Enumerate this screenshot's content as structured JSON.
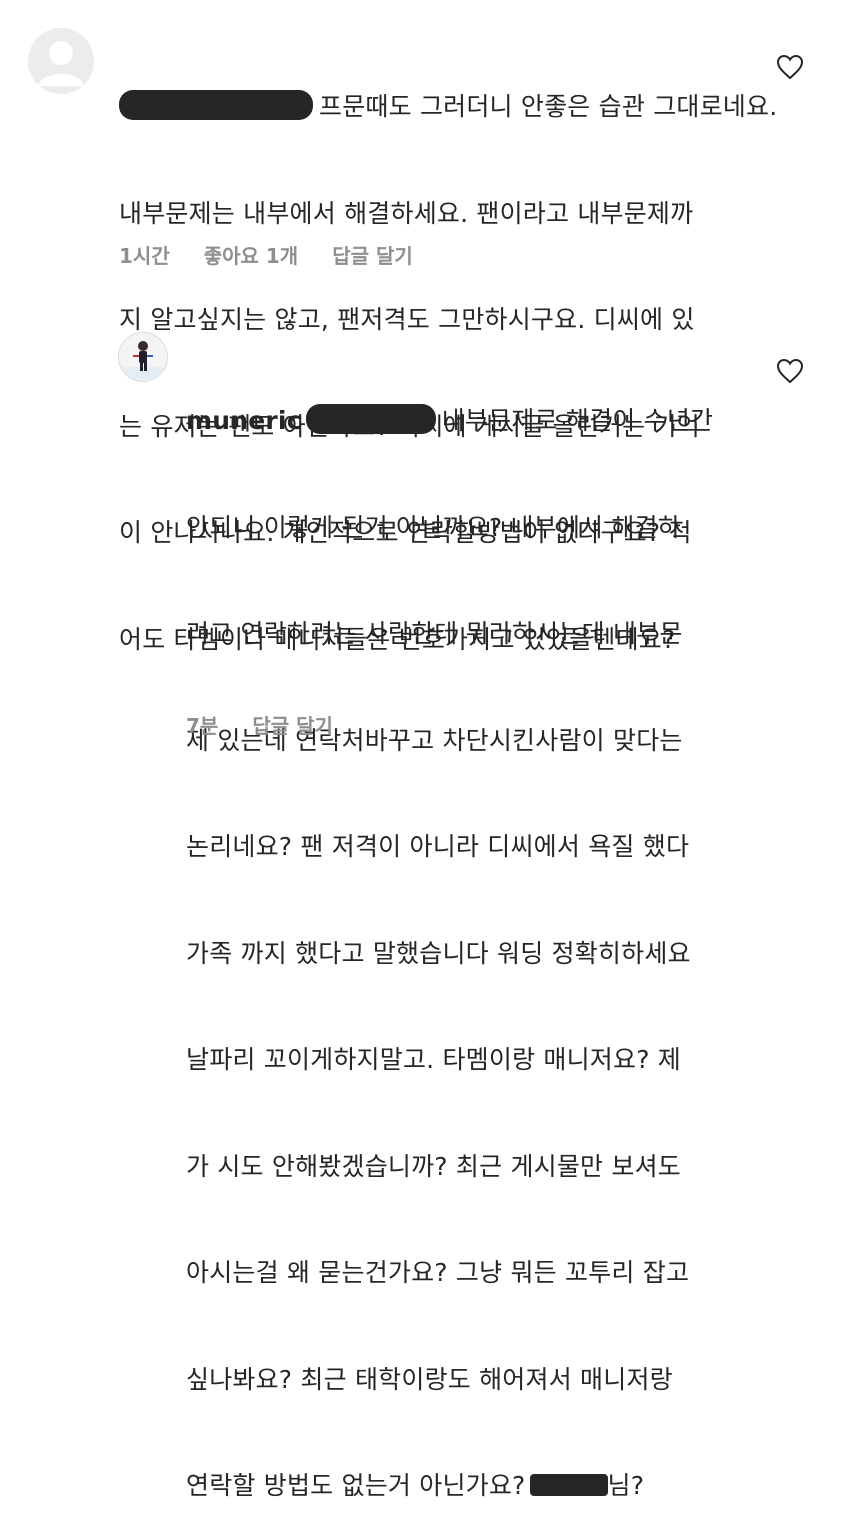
{
  "comments": [
    {
      "username": "",
      "lines": [
        "프문때도 그러더니 안좋은 습관 그대로네요.",
        "내부문제는 내부에서 해결하세요. 팬이라고 내부문제까",
        "지 알고싶지는 않고, 팬저격도 그만하시구요. 디씨에 있",
        "는 유저는 팬도 아닌가요? 디씨에 게시글 올린거는 기억",
        "이 안나시나요. 개인적으로 연락할방법이 없다구요? 적",
        "어도 타멤이나 매니저들은 번호가지고 있었을텐데요?"
      ],
      "time": "1시간",
      "likes": "좋아요 1개",
      "reply": "답글 달기"
    },
    {
      "username": "muneric",
      "lines": [
        "내부문제로 해결이 수년간",
        "안되니 이렇게 된거 아닐까요? 내부에서 해결하",
        "려고 연락하려는 사람한테 뭐라하시는데 내부문",
        "제 있는데 연락처바꾸고 차단시킨사람이 맞다는",
        "논리네요? 팬 저격이 아니라 디씨에서 욕질 했다",
        "가족 까지 했다고 말했습니다 워딩 정확히하세요",
        "날파리 꼬이게하지말고. 타멤이랑 매니저요? 제",
        "가 시도 안해봤겠습니까? 최근 게시물만 보셔도",
        "아시는걸 왜 묻는건가요? 그냥 뭐든 꼬투리 잡고",
        "싶나봐요? 최근 태학이랑도 해어져서 매니저랑",
        "연락할 방법도 없는거 아닌가요?",
        "님?"
      ],
      "time": "7분",
      "reply": "답글 달기"
    }
  ],
  "icons": {
    "avatar_default": "default-avatar-icon",
    "avatar_photo": "profile-photo",
    "like": "heart-outline-icon"
  },
  "colors": {
    "text": "#262626",
    "meta": "#8e8e8e",
    "redaction": "#262626"
  }
}
